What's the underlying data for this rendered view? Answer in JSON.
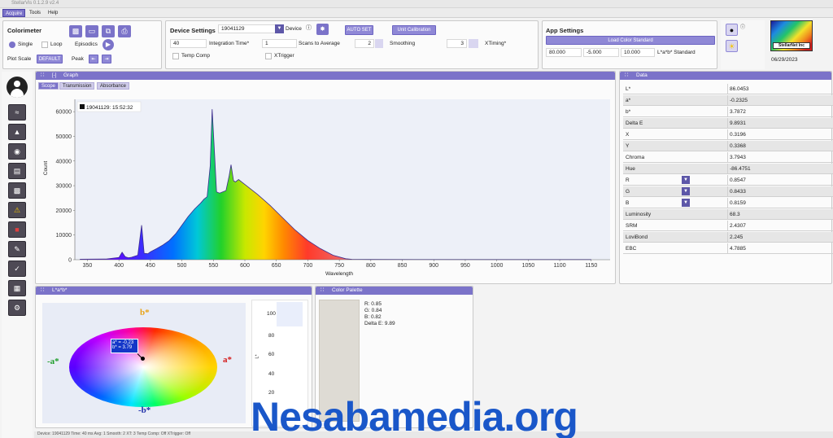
{
  "window": {
    "title": "StellarVis 0.1.2.9 v2.4"
  },
  "menu": [
    {
      "label": "Acquire",
      "active": true
    },
    {
      "label": "Tools",
      "active": false
    },
    {
      "label": "Help",
      "active": false
    }
  ],
  "colorimeter": {
    "title": "Colorimeter",
    "single_label": "Single",
    "loop_label": "Loop",
    "episodics_label": "Episodics",
    "plot_scale_label": "Plot Scale",
    "plot_scale_value": "DEFAULT",
    "peak_label": "Peak"
  },
  "device_settings": {
    "title": "Device Settings",
    "device_id": "19041129",
    "device_label": "Device",
    "auto_set_label": "AUTO SET",
    "unit_calibration_label": "Unit Calibration",
    "integration_time_value": "40",
    "integration_time_label": "Integration Time*",
    "scans_value": "1",
    "scans_label": "Scans to Average",
    "smoothing_value": "2",
    "smoothing_label": "Smoothing",
    "xtiming_value": "3",
    "xtiming_label": "XTiming*",
    "temp_comp_label": "Temp Comp",
    "xtrigger_label": "XTrigger"
  },
  "app_settings": {
    "title": "App Settings",
    "load_color_label": "Load Color Standard",
    "l_value": "80.000",
    "a_value": "-5.000",
    "b_value": "10.000",
    "standard_label": "L*a*b* Standard"
  },
  "logo": {
    "company": "StellarNet Inc",
    "date": "06/29/2023"
  },
  "graph": {
    "title": "Graph",
    "tabs": [
      {
        "label": "Scope",
        "active": true
      },
      {
        "label": "Transmission",
        "active": false
      },
      {
        "label": "Absorbance",
        "active": false
      }
    ]
  },
  "data_panel": {
    "title": "Data",
    "rows": [
      {
        "key": "L*",
        "value": "86.0453"
      },
      {
        "key": "a*",
        "value": "-0.2325"
      },
      {
        "key": "b*",
        "value": "3.7872"
      },
      {
        "key": "Delta E",
        "value": "9.8931"
      },
      {
        "key": "X",
        "value": "0.3196"
      },
      {
        "key": "Y",
        "value": "0.3368"
      },
      {
        "key": "Chroma",
        "value": "3.7943"
      },
      {
        "key": "Hue",
        "value": "-86.4751"
      },
      {
        "key": "R",
        "value": "0.8547",
        "dropdown": true
      },
      {
        "key": "G",
        "value": "0.8433",
        "dropdown": true
      },
      {
        "key": "B",
        "value": "0.8159",
        "dropdown": true
      },
      {
        "key": "Luminosity",
        "value": "68.3"
      },
      {
        "key": "SRM",
        "value": "2.4307"
      },
      {
        "key": "LoviBond",
        "value": "2.245"
      },
      {
        "key": "EBC",
        "value": "4.7885"
      }
    ]
  },
  "lab_panel": {
    "title": "L*a*b*",
    "b_plus": "b*",
    "b_minus": "-b*",
    "a_plus": "a*",
    "a_minus": "-a*",
    "marker_a": "a* = -0.23",
    "marker_b": "b* = 3.79",
    "l_axis_label": "L*",
    "l_ticks": [
      "100",
      "80",
      "60",
      "40",
      "20"
    ]
  },
  "color_palette": {
    "title": "Color Palette",
    "swatch_color": "#dedbd4",
    "r": "R: 0.85",
    "g": "G: 0.84",
    "b": "B: 0.82",
    "delta_e": "Delta E: 9.89"
  },
  "status": {
    "text": "Device: 19041129  Time: 40 ms  Avg: 1  Smooth: 2  XT: 3  Temp Comp: Off  XTrigger: Off"
  },
  "watermark": "Nesabamedia.org",
  "chart_data": {
    "type": "line",
    "title": "",
    "legend": [
      "19041129:  15:52:32"
    ],
    "xlabel": "Wavelength",
    "ylabel": "Count",
    "xlim": [
      330,
      1180
    ],
    "ylim": [
      0,
      65000
    ],
    "xticks": [
      350,
      400,
      450,
      500,
      550,
      600,
      650,
      700,
      750,
      800,
      850,
      900,
      950,
      1000,
      1050,
      1100,
      1150
    ],
    "yticks": [
      0,
      10000,
      20000,
      30000,
      40000,
      50000,
      60000
    ],
    "series": [
      {
        "name": "19041129:  15:52:32",
        "x": [
          338,
          380,
          400,
          405,
          410,
          415,
          420,
          430,
          436,
          440,
          446,
          450,
          460,
          470,
          480,
          490,
          500,
          510,
          520,
          530,
          535,
          540,
          545,
          548,
          552,
          555,
          560,
          570,
          575,
          578,
          582,
          585,
          590,
          600,
          620,
          640,
          660,
          680,
          700,
          720,
          740,
          760,
          770,
          800,
          1000,
          1150
        ],
        "y": [
          200,
          300,
          900,
          3000,
          1200,
          800,
          1000,
          1800,
          14000,
          2600,
          2400,
          3200,
          4500,
          6000,
          7800,
          10500,
          14000,
          17500,
          20500,
          23000,
          24500,
          25500,
          38000,
          61000,
          42000,
          27500,
          27000,
          28000,
          34000,
          38500,
          32000,
          31500,
          32500,
          30500,
          26500,
          22000,
          17000,
          12000,
          7800,
          4500,
          1800,
          400,
          150,
          100,
          80,
          60
        ]
      }
    ]
  }
}
